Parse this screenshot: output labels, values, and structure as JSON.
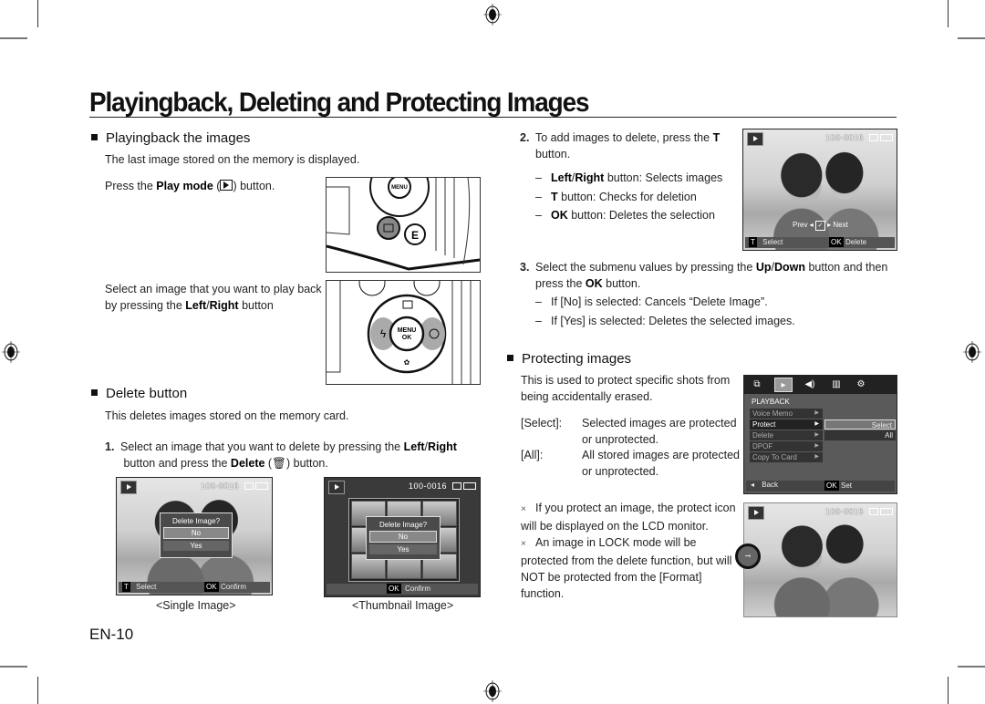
{
  "page": {
    "title": "Playingback, Deleting and Protecting Images",
    "page_number": "EN-10"
  },
  "playback": {
    "heading": "Playingback the images",
    "intro": "The last image stored on the memory is displayed.",
    "press_pre": "Press the ",
    "press_bold": "Play mode",
    "press_post": " button.",
    "select_pre": "Select an image that you want to play back by pressing the ",
    "select_bold1": "Left",
    "select_sep": "/",
    "select_bold2": "Right",
    "select_post": " button",
    "camera1": {
      "menu_label": "MENU OK",
      "e_button": "E"
    },
    "camera2": {
      "menu_label": "MENU OK"
    }
  },
  "delete": {
    "heading": "Delete button",
    "intro": "This deletes images stored on the memory card.",
    "step1": {
      "num": "1.",
      "pre": "Select an image that you want to delete by pressing the ",
      "bold1": "Left",
      "sep": "/",
      "bold2": "Right",
      "mid": " button and press the ",
      "bold3": "Delete",
      "post": " button."
    },
    "single_screen": {
      "counter": "100-0016",
      "dialog_title": "Delete Image?",
      "options": [
        "No",
        "Yes"
      ],
      "bottom_key1": "T",
      "bottom_label1": "Select",
      "bottom_key2": "OK",
      "bottom_label2": "Confirm",
      "caption": "<Single Image>"
    },
    "thumb_screen": {
      "counter": "100-0016",
      "dialog_title": "Delete Image?",
      "options": [
        "No",
        "Yes"
      ],
      "bottom_key": "OK",
      "bottom_label": "Confirm",
      "caption": "<Thumbnail Image>"
    },
    "step2": {
      "num": "2.",
      "pre": "To add images to delete, press the ",
      "bold": "T",
      "post": " button.",
      "bullets": [
        {
          "bold": "Left",
          "sep": "/",
          "bold2": "Right",
          "text": " button: Selects images"
        },
        {
          "bold": "T",
          "text": " button: Checks for deletion"
        },
        {
          "bold": "OK",
          "text": " button: Deletes the selection"
        }
      ],
      "screen": {
        "counter": "100-0016",
        "prev": "Prev",
        "next": "Next",
        "bottom_key1": "T",
        "bottom_label1": "Select",
        "bottom_key2": "OK",
        "bottom_label2": "Delete"
      }
    },
    "step3": {
      "num": "3.",
      "pre": "Select the submenu values by pressing the ",
      "bold1": "Up",
      "sep": "/",
      "bold2": "Down",
      "mid": " button and then press the ",
      "bold3": "OK",
      "post": " button.",
      "bullets": [
        "If [No] is selected: Cancels “Delete Image”.",
        "If [Yes] is selected: Deletes the selected images."
      ]
    }
  },
  "protect": {
    "heading": "Protecting images",
    "intro": "This is used to protect specific shots from being accidentally erased.",
    "defs": [
      {
        "term": "[Select]:",
        "desc": "Selected images are protected or unprotected."
      },
      {
        "term": "[All]:",
        "desc": "All stored images are protected or unprotected."
      }
    ],
    "menu_screen": {
      "section": "PLAYBACK",
      "items": [
        "Voice Memo",
        "Protect",
        "Delete",
        "DPOF",
        "Copy To Card"
      ],
      "selected_item": "Protect",
      "options": [
        "Select",
        "All"
      ],
      "selected_option": "Select",
      "bottom_label1": "Back",
      "bottom_key2": "OK",
      "bottom_label2": "Set"
    },
    "notes": [
      "If you protect an image, the protect icon will be displayed on the LCD monitor.",
      "An image in LOCK mode will be protected from the delete function, but will NOT be protected from the [Format] function."
    ],
    "note_marker": "×",
    "lock_screen": {
      "counter": "100-0016"
    }
  }
}
